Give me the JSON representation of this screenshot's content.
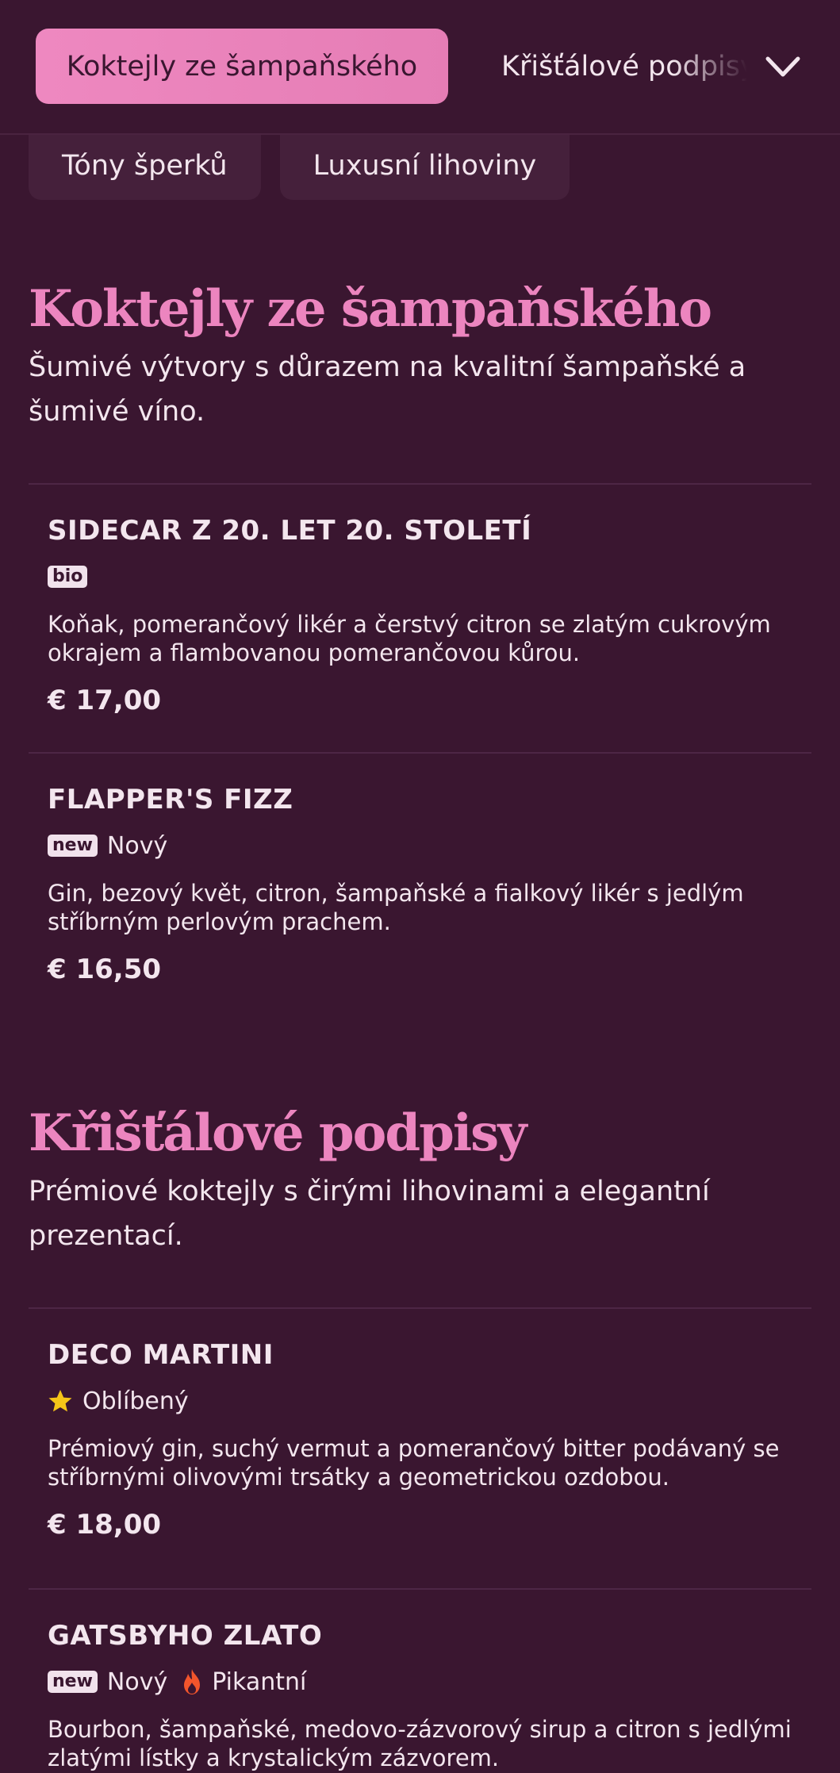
{
  "nav": {
    "active_tab": "Koktejly ze šampaňského",
    "next_tab": "Křišťálové podpisy",
    "chips": [
      "Tóny šperků",
      "Luxusní lihoviny"
    ]
  },
  "sections": [
    {
      "title": "Koktejly ze šampaňského",
      "description": "Šumivé výtvory s důrazem na kvalitní šampaňské a šumivé víno.",
      "items": [
        {
          "name": "SIDECAR Z 20. LET 20. STOLETÍ",
          "badge": "bio",
          "description": "Koňak, pomerančový likér a čerstvý citron se zlatým cukrovým okrajem a flambovanou pomerančovou kůrou.",
          "price": "€ 17,00"
        },
        {
          "name": "FLAPPER'S FIZZ",
          "badge": "new",
          "badge_label": "Nový",
          "description": "Gin, bezový květ, citron, šampaňské a fialkový likér s jedlým stříbrným perlovým prachem.",
          "price": "€ 16,50"
        }
      ]
    },
    {
      "title": "Křišťálové podpisy",
      "description": "Prémiové koktejly s čirými lihovinami a elegantní prezentací.",
      "items": [
        {
          "name": "DECO MARTINI",
          "icon": "star-icon",
          "tag_label": "Oblíbený",
          "description": "Prémiový gin, suchý vermut a pomerančový bitter podávaný se stříbrnými olivovými trsátky a geometrickou ozdobou.",
          "price": "€ 18,00"
        },
        {
          "name": "GATSBYHO ZLATO",
          "badge": "new",
          "badge_label": "Nový",
          "icon": "fire-icon",
          "tag_label": "Pikantní",
          "description": "Bourbon, šampaňské, medovo-zázvorový sirup a citron s jedlými zlatými lístky a krystalickým zázvorem."
        }
      ]
    }
  ],
  "colors": {
    "background": "#3a1630",
    "accent": "#ec85bf",
    "star": "#f5c518",
    "fire": "#f2552c"
  }
}
